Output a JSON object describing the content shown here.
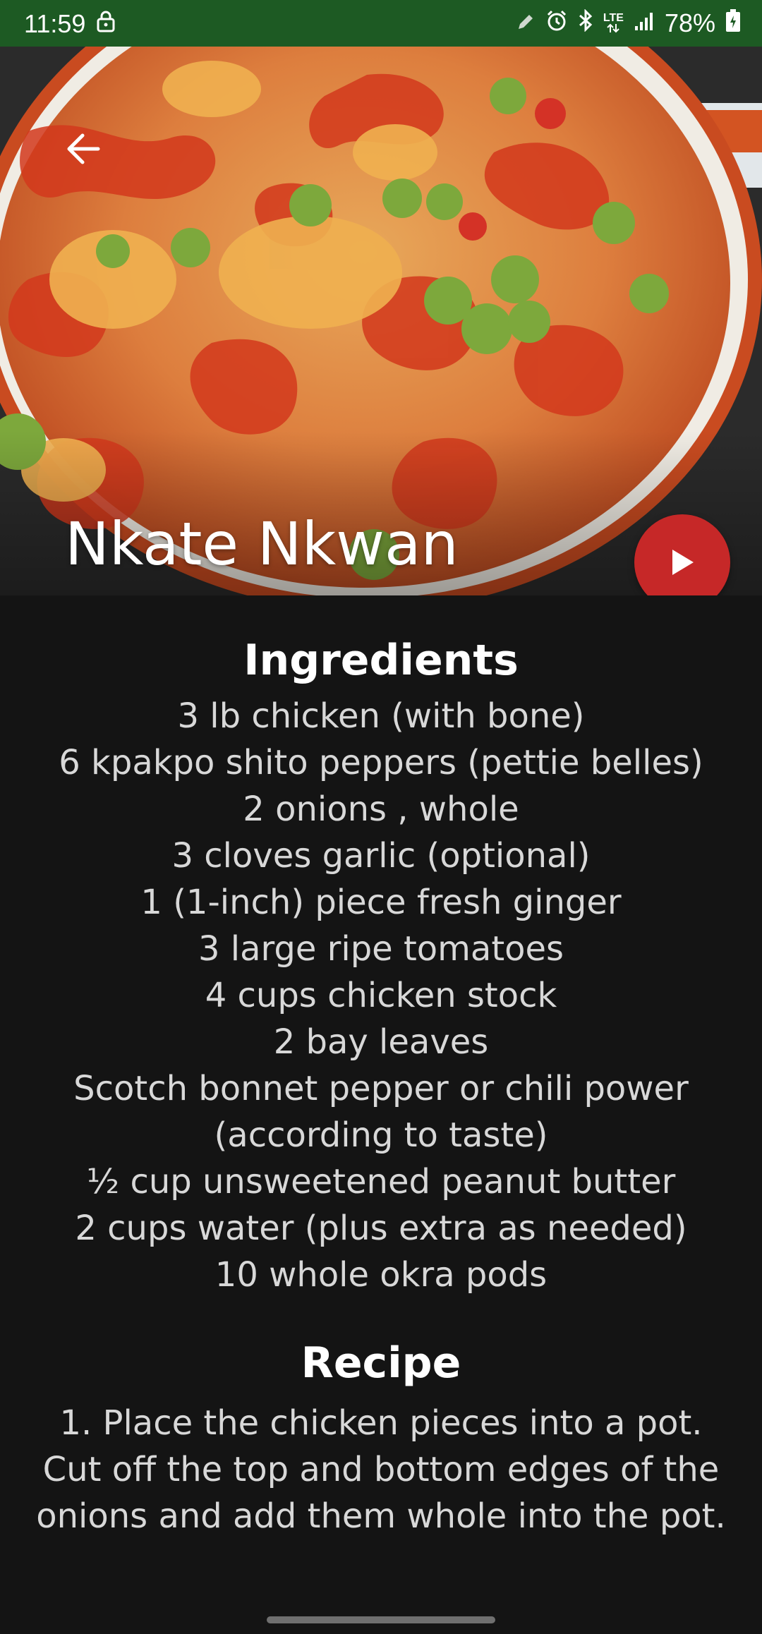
{
  "status_bar": {
    "time": "11:59",
    "network": "LTE",
    "battery": "78%"
  },
  "hero": {
    "title": "Nkate Nkwan"
  },
  "ingredients": {
    "heading": "Ingredients",
    "items": [
      "3 lb chicken (with bone)",
      "6 kpakpo shito peppers (pettie belles)",
      "2 onions , whole",
      "3 cloves garlic (optional)",
      "1 (1-inch) piece fresh ginger",
      "3 large ripe tomatoes",
      "4 cups chicken stock",
      "2 bay leaves",
      "Scotch bonnet pepper or chili power (according to taste)",
      "½ cup unsweetened peanut butter",
      "2 cups water (plus extra as needed)",
      "10 whole okra pods"
    ]
  },
  "recipe": {
    "heading": "Recipe",
    "step_1": "1. Place the chicken pieces into a pot. Cut off the top and bottom edges of the onions and add them whole into the pot."
  }
}
